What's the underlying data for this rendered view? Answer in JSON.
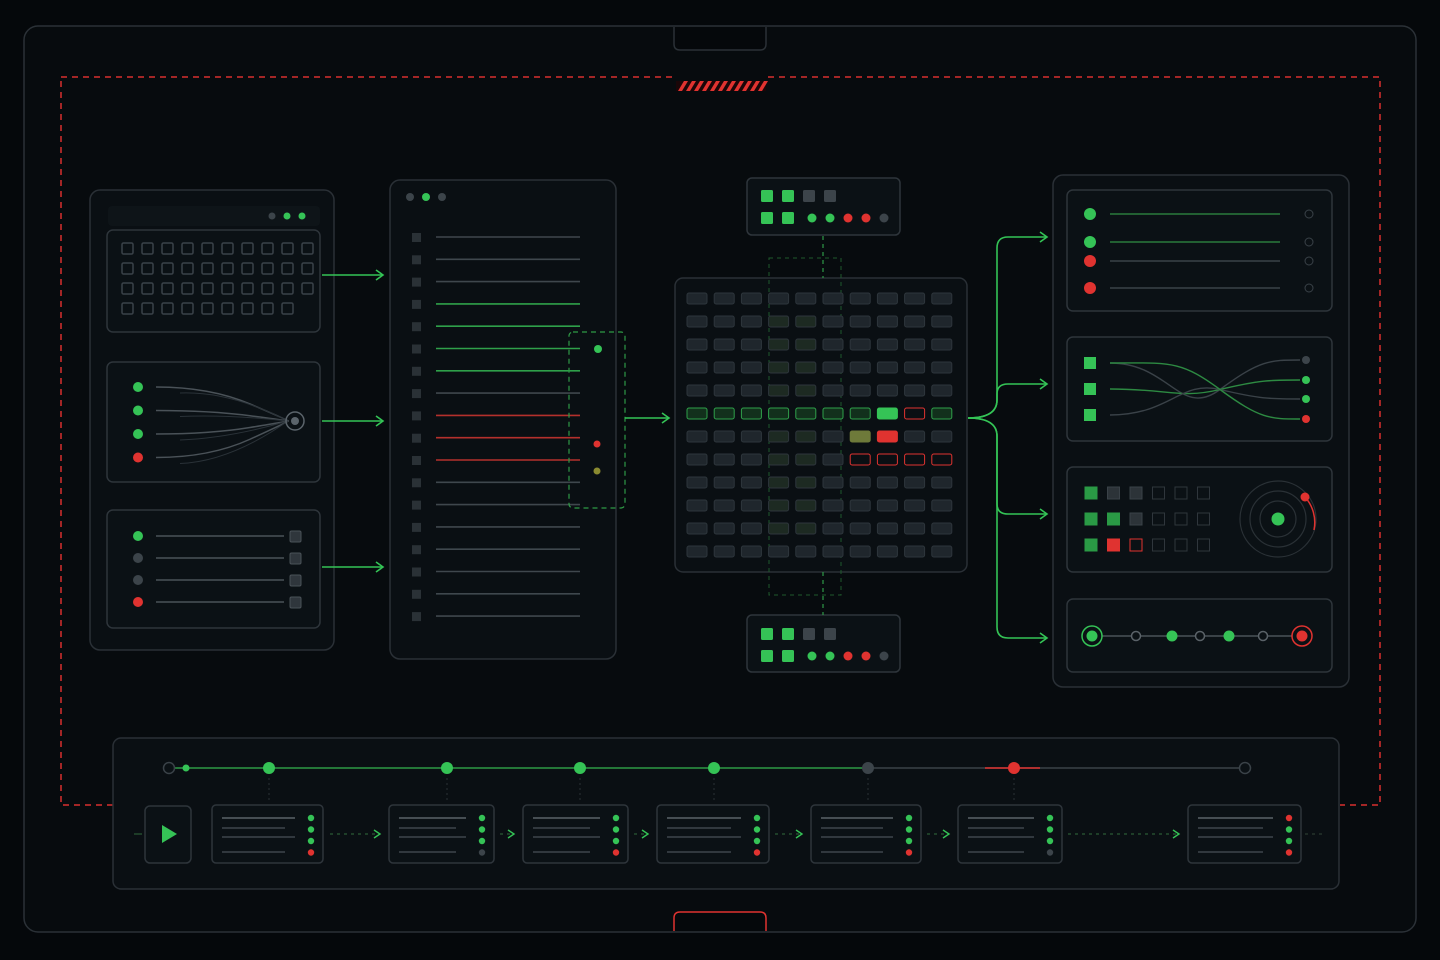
{
  "colors": {
    "accent": "#35c356",
    "alert": "#e03330",
    "inactive": "#3c444a",
    "frame": "#2a3036",
    "background": "#05080b"
  },
  "icons": {
    "top_tab": "hazard-stripes-icon",
    "play": "play-icon",
    "radar": "radar-icon",
    "window_dots": "window-controls-icon"
  },
  "left_cards": [
    {
      "name": "grid-card",
      "status_dots": [
        "grey",
        "green",
        "green"
      ]
    },
    {
      "name": "branch-card",
      "status_dots": [
        "green",
        "green",
        "green",
        "red"
      ]
    },
    {
      "name": "checklist-card",
      "status_dots": [
        "green",
        "grey",
        "grey",
        "red"
      ]
    }
  ],
  "list_panel": {
    "window_dots": [
      "grey",
      "green",
      "grey"
    ],
    "rows": [
      "grey",
      "grey",
      "grey",
      "green",
      "green",
      "green",
      "green",
      "grey",
      "red",
      "red",
      "red",
      "grey",
      "grey",
      "grey",
      "grey",
      "grey",
      "grey",
      "grey"
    ]
  },
  "matrix": {
    "rows": 12,
    "cols": 10,
    "highlight_row": 5,
    "active_cells": [
      [
        5,
        7,
        "green"
      ],
      [
        6,
        6,
        "olive"
      ],
      [
        6,
        7,
        "red"
      ],
      [
        7,
        6,
        "red-outline"
      ],
      [
        7,
        7,
        "red-outline"
      ],
      [
        7,
        8,
        "red-outline"
      ],
      [
        7,
        9,
        "red-outline"
      ],
      [
        5,
        8,
        "red-outline"
      ]
    ]
  },
  "mini_panels": {
    "top": {
      "squares": [
        "green",
        "green",
        "grey",
        "grey",
        "green",
        "green"
      ],
      "dots": [
        "green",
        "green",
        "red",
        "red",
        "grey"
      ]
    },
    "bottom": {
      "squares": [
        "green",
        "green",
        "grey",
        "grey",
        "green",
        "green"
      ],
      "dots": [
        "green",
        "green",
        "red",
        "red",
        "grey"
      ]
    }
  },
  "right_cards": [
    {
      "name": "status-list-card",
      "dots": [
        "green",
        "green",
        "red",
        "red"
      ]
    },
    {
      "name": "wave-card",
      "outputs": [
        "grey",
        "green",
        "green",
        "red"
      ]
    },
    {
      "name": "radar-card",
      "grid": [
        "green",
        "grey",
        "grey",
        "none",
        "none",
        "none",
        "green",
        "green",
        "grey",
        "none",
        "none",
        "none",
        "green",
        "red",
        "red-outline",
        "none",
        "none",
        "none"
      ]
    },
    {
      "name": "pipeline-card",
      "nodes": [
        "green-ring",
        "grey",
        "green",
        "grey",
        "green",
        "grey",
        "red-ring"
      ]
    }
  ],
  "timeline": {
    "milestones": [
      "grey",
      "green",
      "green",
      "green",
      "green",
      "green",
      "grey",
      "red",
      "grey"
    ],
    "steps": [
      {
        "dots": [
          "green",
          "green",
          "green",
          "red"
        ]
      },
      {
        "dots": [
          "green",
          "green",
          "green",
          "grey"
        ]
      },
      {
        "dots": [
          "green",
          "green",
          "green",
          "red"
        ]
      },
      {
        "dots": [
          "green",
          "green",
          "green",
          "red"
        ]
      },
      {
        "dots": [
          "green",
          "green",
          "green",
          "red"
        ]
      },
      {
        "dots": [
          "green",
          "green",
          "green",
          "grey"
        ]
      },
      {
        "dots": [
          "red",
          "green",
          "green",
          "red"
        ]
      }
    ]
  }
}
